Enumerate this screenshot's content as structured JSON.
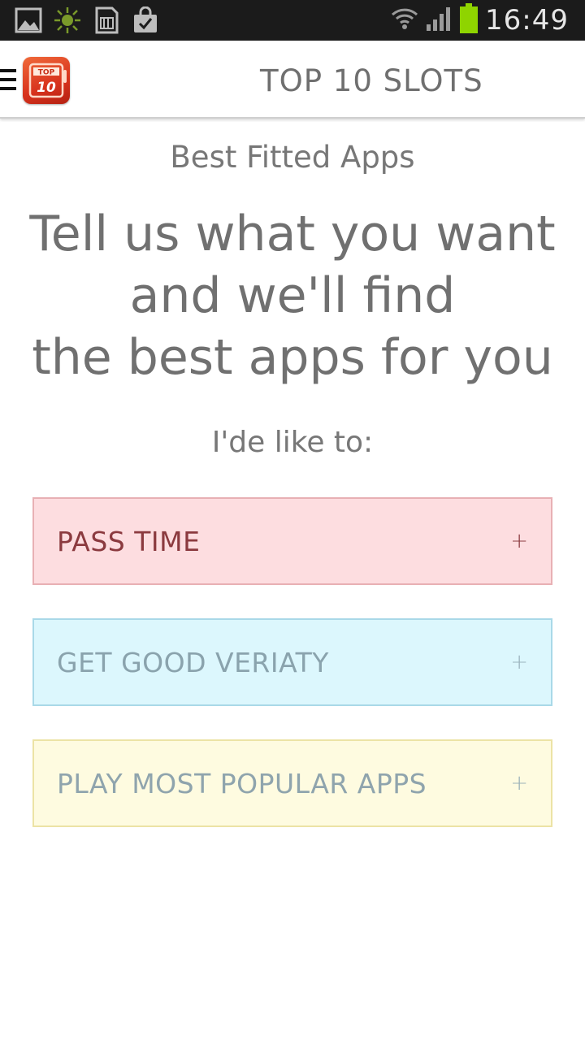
{
  "status_bar": {
    "time": "16:49",
    "icons_left": [
      "gallery-icon",
      "sun-icon",
      "sd-card-icon",
      "shopping-bag-icon"
    ],
    "icons_right": [
      "wifi-icon",
      "signal-icon",
      "battery-icon"
    ],
    "battery_color": "#8fd400"
  },
  "app_bar": {
    "title": "TOP 10 SLOTS",
    "logo_text_top": "TOP",
    "logo_text_bottom": "10"
  },
  "main": {
    "subtitle": "Best Fitted Apps",
    "headline_lines": [
      "Tell us what you want",
      "and we'll find",
      "the best apps for you"
    ],
    "prompt": "I'de like to:",
    "options": [
      {
        "label": "PASS TIME",
        "plus": "+",
        "color": "#fddde0"
      },
      {
        "label": "GET GOOD VERIATY",
        "plus": "+",
        "color": "#dcf7fd"
      },
      {
        "label": "PLAY MOST POPULAR APPS",
        "plus": "+",
        "color": "#fefbe0"
      }
    ]
  }
}
